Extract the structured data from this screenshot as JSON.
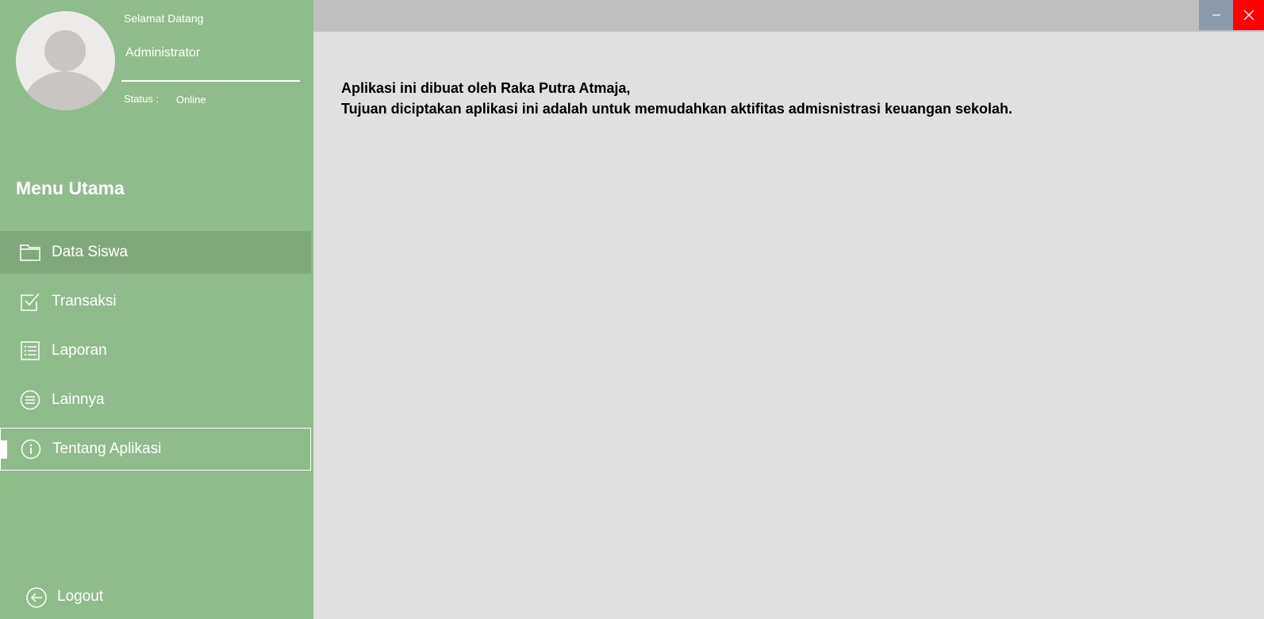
{
  "profile": {
    "welcome": "Selamat Datang",
    "username": "Administrator",
    "status_label": "Status :",
    "status_value": "Online"
  },
  "menu": {
    "title": "Menu Utama",
    "items": [
      {
        "label": "Data Siswa",
        "icon": "folder-icon"
      },
      {
        "label": "Transaksi",
        "icon": "checkbox-icon"
      },
      {
        "label": "Laporan",
        "icon": "list-icon"
      },
      {
        "label": "Lainnya",
        "icon": "menu-circle-icon"
      },
      {
        "label": "Tentang Aplikasi",
        "icon": "info-icon"
      }
    ],
    "hovered_index": 0,
    "selected_index": 4
  },
  "logout": {
    "label": "Logout",
    "icon": "back-arrow-icon"
  },
  "window_controls": {
    "minimize_icon": "minimize-icon",
    "close_icon": "close-icon"
  },
  "content": {
    "line1": "Aplikasi ini dibuat oleh Raka Putra Atmaja,",
    "line2": "Tujuan diciptakan aplikasi ini adalah untuk memudahkan aktifitas admisnistrasi keuangan sekolah."
  },
  "colors": {
    "sidebar": "#8fbc8b",
    "sidebar_hover": "#80a87d",
    "content_bg": "#e0e0e0",
    "titlebar": "#bfbfbf",
    "minimize_button": "#8b9aa8",
    "close_button": "#ff0000"
  }
}
